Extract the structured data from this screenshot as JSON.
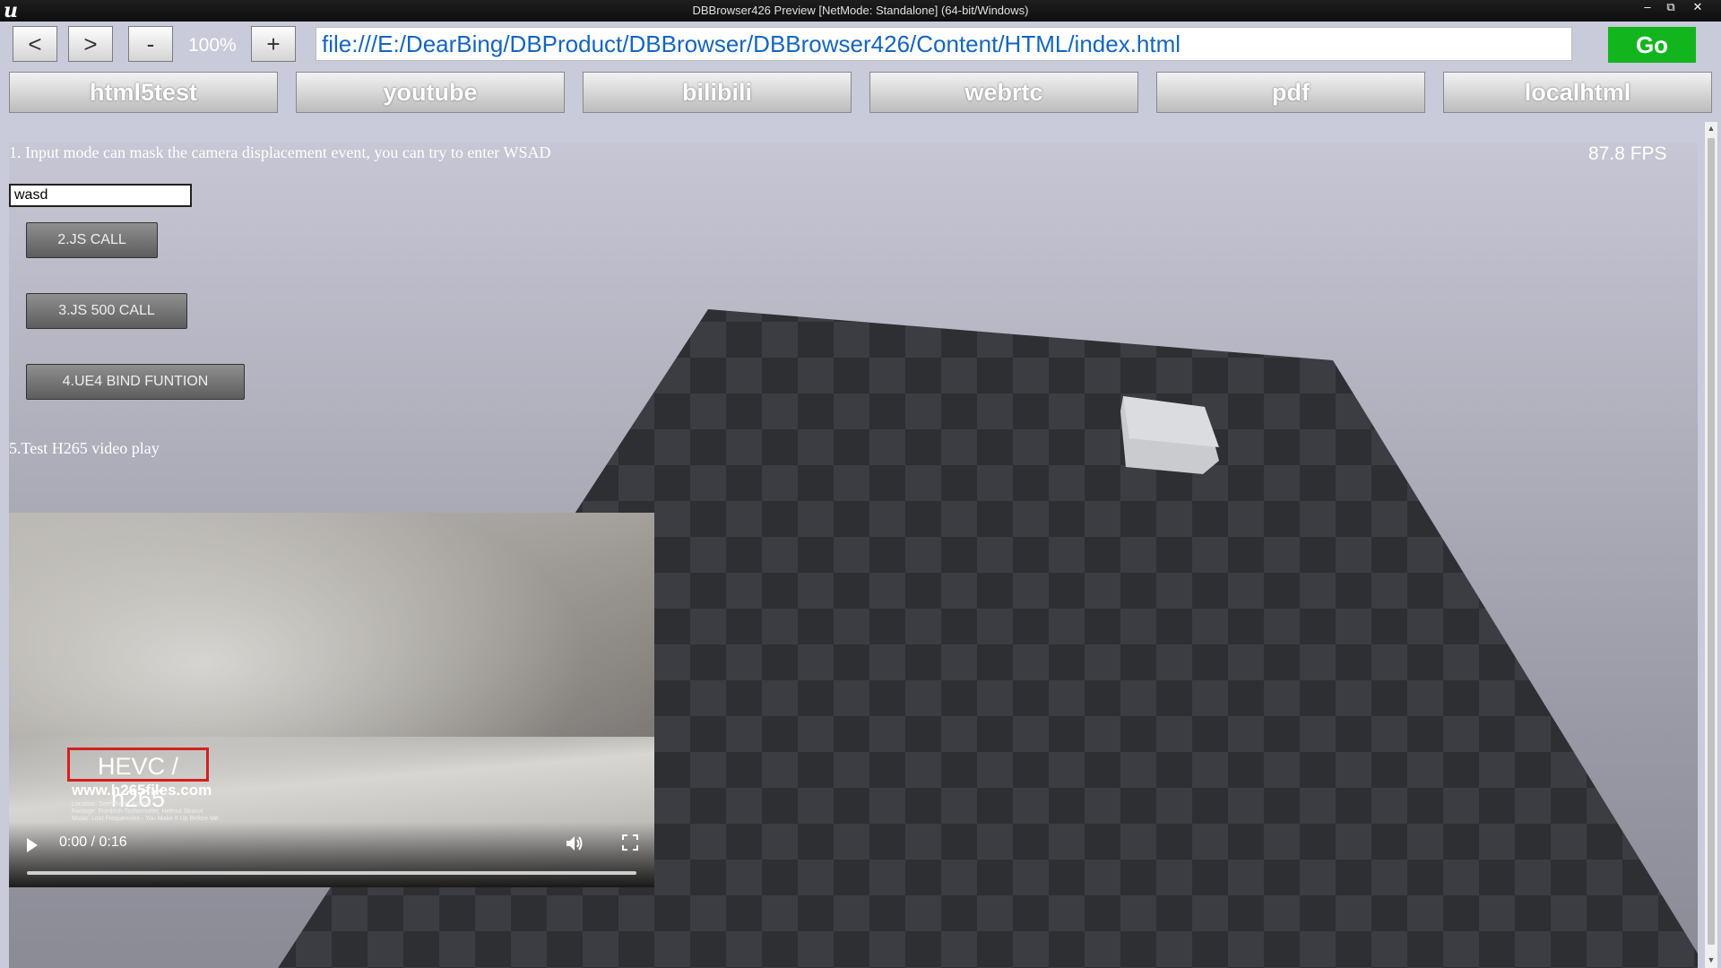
{
  "window": {
    "title": "DBBrowser426 Preview [NetMode: Standalone]  (64-bit/Windows)",
    "logo": "u",
    "minimize_icon": "minimize-icon",
    "restore_icon": "restore-icon",
    "close_icon": "close-icon"
  },
  "navbar": {
    "back_label": "<",
    "forward_label": ">",
    "zoom_out_label": "-",
    "zoom_level": "100%",
    "zoom_in_label": "+",
    "url": "file:///E:/DearBing/DBProduct/DBBrowser/DBBrowser426/Content/HTML/index.html",
    "go_label": "Go",
    "go_color": "#13b51f"
  },
  "bookmarks": [
    "html5test",
    "youtube",
    "bilibili",
    "webrtc",
    "pdf",
    "localhtml"
  ],
  "page": {
    "fps": "87.8 FPS",
    "instruction": "1. Input mode can mask the camera displacement event, you can try to enter WSAD",
    "input_value": "wasd",
    "js_call_label": "2.JS CALL",
    "js_500_call_label": "3.JS 500 CALL",
    "ue4_bind_label": "4.UE4 BIND FUNTION",
    "h265_label": "5.Test H265 video play"
  },
  "video": {
    "overlay_title": "HEVC / h265",
    "overlay_url": "www.h265files.com",
    "credit_line1": "Location:   Seefahrer / Austria",
    "credit_line2": "Footage:    Friedrich Tschernutter, Helmut Stranzl",
    "credit_line3": "Music:      Lost Frequencies - You Make It Up Before Me",
    "time": "0:00 / 0:16",
    "progress": 0.0,
    "play_icon": "play-icon",
    "volume_icon": "volume-icon",
    "fullscreen_icon": "fullscreen-icon"
  }
}
